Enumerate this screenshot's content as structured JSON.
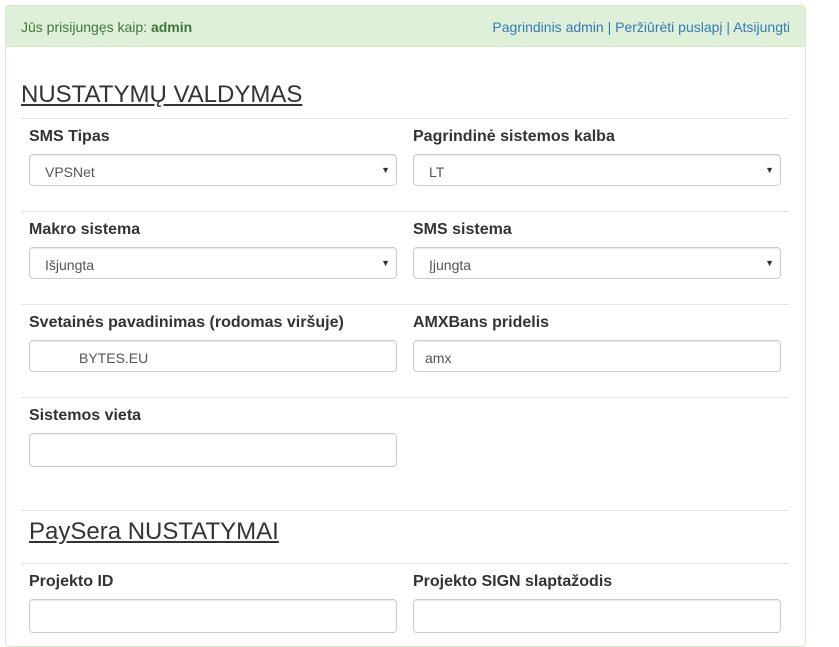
{
  "header": {
    "login_prefix": "Jūs prisijungęs kaip:",
    "username": "admin",
    "links": [
      "Pagrindinis admin",
      "Peržiūrėti puslapį",
      "Atsijungti"
    ],
    "separator": "|"
  },
  "settings": {
    "title": "NUSTATYMŲ VALDYMAS",
    "sms_type": {
      "label": "SMS Tipas",
      "value": "VPSNet"
    },
    "main_language": {
      "label": "Pagrindinė sistemos kalba",
      "value": "LT"
    },
    "macro_system": {
      "label": "Makro sistema",
      "value": "Išjungta"
    },
    "sms_system": {
      "label": "SMS sistema",
      "value": "Įjungta"
    },
    "site_name": {
      "label": "Svetainės pavadinimas (rodomas viršuje)",
      "value": "BYTES.EU"
    },
    "amxbans_prefix": {
      "label": "AMXBans pridelis",
      "value": "amx"
    },
    "system_location": {
      "label": "Sistemos vieta",
      "value": ""
    }
  },
  "paysera": {
    "title": "PaySera NUSTATYMAI",
    "project_id": {
      "label": "Projekto ID",
      "value": ""
    },
    "project_sign": {
      "label": "Projekto SIGN slaptažodis",
      "value": ""
    }
  },
  "icons": {
    "caret": "▼"
  }
}
